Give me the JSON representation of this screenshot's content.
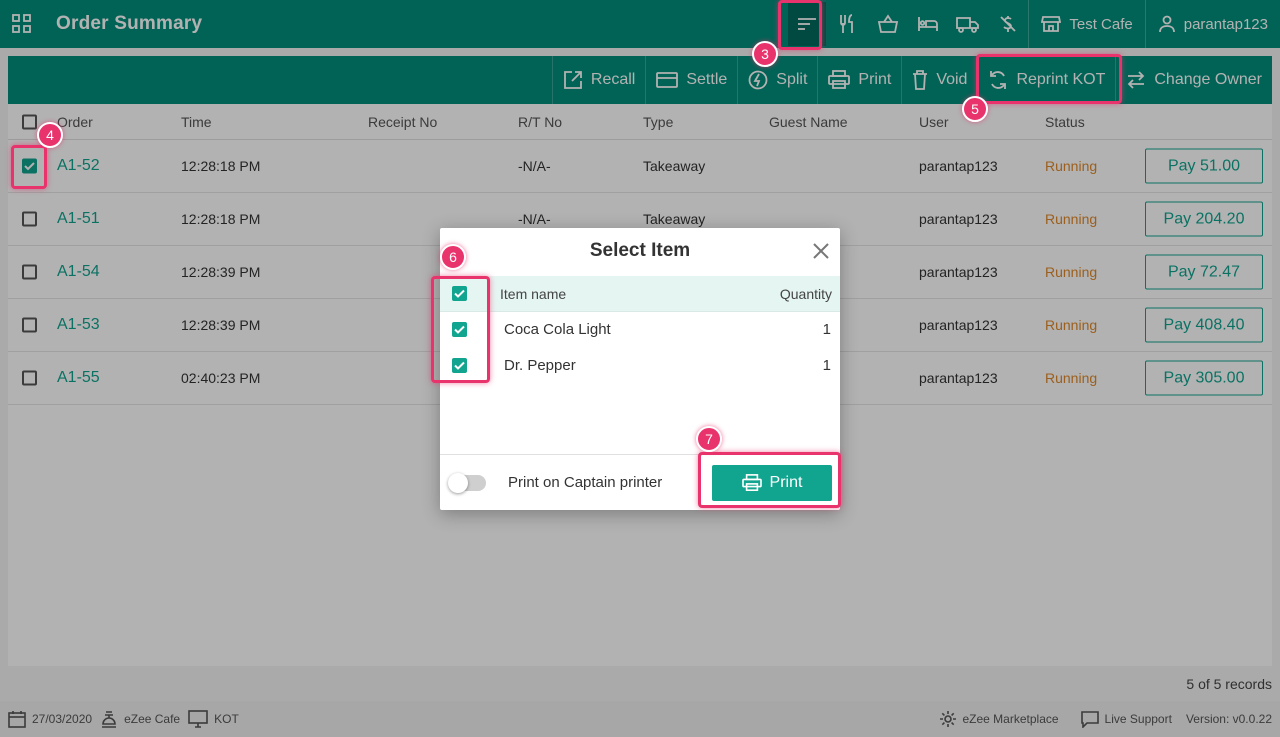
{
  "header": {
    "title": "Order Summary",
    "cafe": "Test Cafe",
    "user": "parantap123"
  },
  "toolbar": {
    "recall": "Recall",
    "settle": "Settle",
    "split": "Split",
    "print": "Print",
    "void": "Void",
    "reprint_kot": "Reprint KOT",
    "change_owner": "Change Owner"
  },
  "table": {
    "columns": {
      "order": "Order",
      "time": "Time",
      "receipt": "Receipt No",
      "rt": "R/T No",
      "type": "Type",
      "guest": "Guest Name",
      "user": "User",
      "status": "Status"
    },
    "rows": [
      {
        "order": "A1-52",
        "time": "12:28:18 PM",
        "receipt": "",
        "rt": "-N/A-",
        "type": "Takeaway",
        "guest": "",
        "user": "parantap123",
        "status": "Running",
        "pay": "Pay 51.00",
        "checked": true
      },
      {
        "order": "A1-51",
        "time": "12:28:18 PM",
        "receipt": "",
        "rt": "-N/A-",
        "type": "Takeaway",
        "guest": "",
        "user": "parantap123",
        "status": "Running",
        "pay": "Pay 204.20",
        "checked": false
      },
      {
        "order": "A1-54",
        "time": "12:28:39 PM",
        "receipt": "",
        "rt": "",
        "type": "",
        "guest": "",
        "user": "parantap123",
        "status": "Running",
        "pay": "Pay 72.47",
        "checked": false
      },
      {
        "order": "A1-53",
        "time": "12:28:39 PM",
        "receipt": "",
        "rt": "",
        "type": "",
        "guest": "",
        "user": "parantap123",
        "status": "Running",
        "pay": "Pay 408.40",
        "checked": false
      },
      {
        "order": "A1-55",
        "time": "02:40:23 PM",
        "receipt": "",
        "rt": "",
        "type": "",
        "guest": "",
        "user": "parantap123",
        "status": "Running",
        "pay": "Pay 305.00",
        "checked": false
      }
    ],
    "records": "5 of 5 records"
  },
  "modal": {
    "title": "Select Item",
    "col_item": "Item name",
    "col_qty": "Quantity",
    "items": [
      {
        "name": "Coca Cola Light",
        "qty": "1"
      },
      {
        "name": "Dr. Pepper",
        "qty": "1"
      }
    ],
    "toggle_label": "Print on Captain printer",
    "print_label": "Print"
  },
  "footer": {
    "date": "27/03/2020",
    "outlet": "eZee Cafe",
    "mode": "KOT",
    "marketplace": "eZee Marketplace",
    "support": "Live Support",
    "version": "Version: v0.0.22"
  },
  "annotations": [
    "3",
    "4",
    "5",
    "6",
    "7"
  ],
  "colors": {
    "brand": "#008f7c",
    "accent": "#11a48f",
    "running": "#e0892a",
    "highlight": "#e8336d"
  }
}
